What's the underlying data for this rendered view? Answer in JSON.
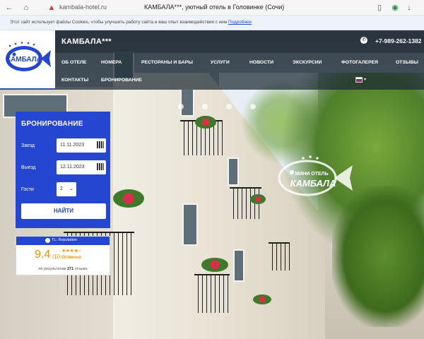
{
  "browser": {
    "url": "kambala-hotel.ru",
    "tab_title": "КАМБАЛА***, уютный отель в Головинке (Сочи)"
  },
  "cookie": {
    "text": "Этот сайт использует файлы Cookies, чтобы улучшить работу сайта и ваш опыт взаимодействия с ним",
    "link": "Подробнее"
  },
  "header": {
    "brand": "КАМБАЛА***",
    "phone": "+7-989-262-1382",
    "logo_text": "КАМБАЛА"
  },
  "nav": {
    "row1": [
      "ОБ ОТЕЛЕ",
      "НОМЕРА",
      "РЕСТОРАНЫ И БАРЫ",
      "УСЛУГИ",
      "НОВОСТИ",
      "ЭКСКУРСИИ",
      "ФОТОГАЛЕРЕЯ",
      "ОТЗЫВЫ"
    ],
    "row2": [
      "КОНТАКТЫ",
      "БРОНИРОВАНИЕ"
    ],
    "language": "ru"
  },
  "watermark": {
    "line1": "МИНИ ОТЕЛЬ",
    "line2": "КАМБАЛА"
  },
  "booking": {
    "title": "БРОНИРОВАНИЕ",
    "checkin_label": "Заезд",
    "checkin_value": "11.11.2023",
    "checkout_label": "Выезд",
    "checkout_value": "12.11.2023",
    "guests_label": "Гости",
    "guests_value": "2",
    "search_label": "НАЙТИ"
  },
  "rating": {
    "brand": "TL: Reputation",
    "score": "9.4",
    "scale": "/10",
    "stars": 4.5,
    "word": "Отлично",
    "footer_prefix": "по результатам",
    "count": "271",
    "footer_suffix": "отзыва"
  },
  "colors": {
    "accent": "#2446d1",
    "rating": "#f29400",
    "header_bg": "#232d37"
  }
}
